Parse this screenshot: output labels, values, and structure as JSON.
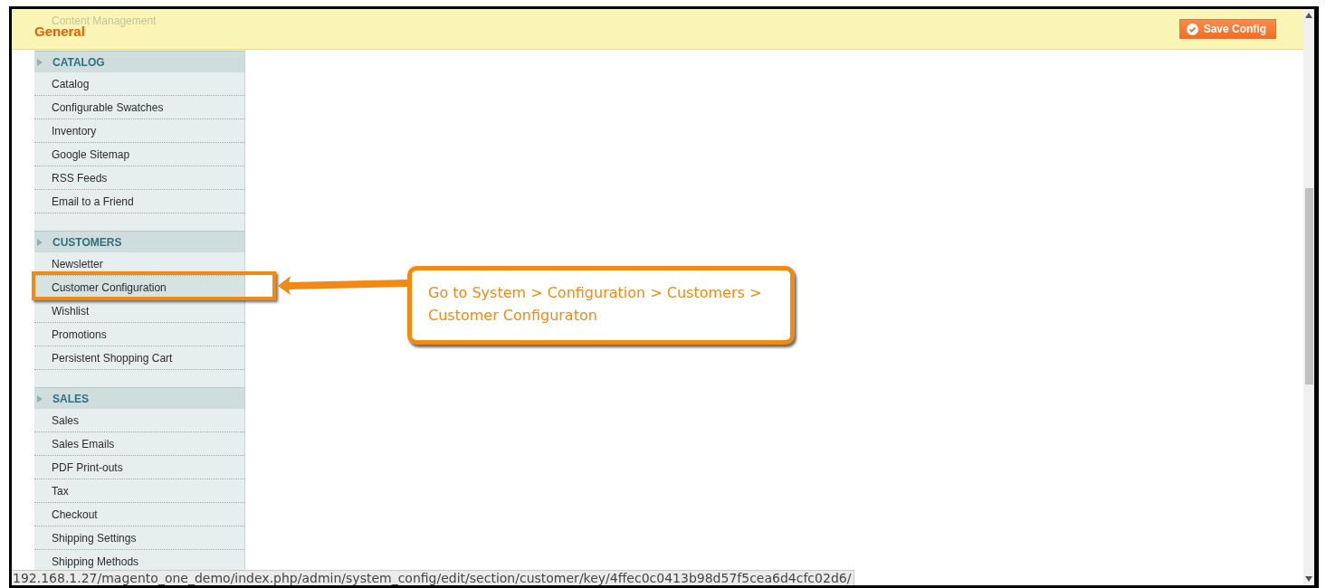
{
  "header": {
    "title": "General",
    "faded_title": "Content Management",
    "save_button": "Save Config"
  },
  "sidebar": {
    "sections": [
      {
        "title": "CATALOG",
        "items": [
          {
            "label": "Catalog",
            "selected": false
          },
          {
            "label": "Configurable Swatches",
            "selected": false
          },
          {
            "label": "Inventory",
            "selected": false
          },
          {
            "label": "Google Sitemap",
            "selected": false
          },
          {
            "label": "RSS Feeds",
            "selected": false
          },
          {
            "label": "Email to a Friend",
            "selected": false
          }
        ]
      },
      {
        "title": "CUSTOMERS",
        "items": [
          {
            "label": "Newsletter",
            "selected": false
          },
          {
            "label": "Customer Configuration",
            "selected": true
          },
          {
            "label": "Wishlist",
            "selected": false
          },
          {
            "label": "Promotions",
            "selected": false
          },
          {
            "label": "Persistent Shopping Cart",
            "selected": false
          }
        ]
      },
      {
        "title": "SALES",
        "items": [
          {
            "label": "Sales",
            "selected": false
          },
          {
            "label": "Sales Emails",
            "selected": false
          },
          {
            "label": "PDF Print-outs",
            "selected": false
          },
          {
            "label": "Tax",
            "selected": false
          },
          {
            "label": "Checkout",
            "selected": false
          },
          {
            "label": "Shipping Settings",
            "selected": false
          },
          {
            "label": "Shipping Methods",
            "selected": false
          }
        ]
      }
    ]
  },
  "callout": {
    "text": "Go to System > Configuration > Customers > Customer Configuraton"
  },
  "status_bar": {
    "url": "192.168.1.27/magento_one_demo/index.php/admin/system_config/edit/section/customer/key/4ffec0c0413b98d57f5cea6d4cfc02d6/"
  }
}
